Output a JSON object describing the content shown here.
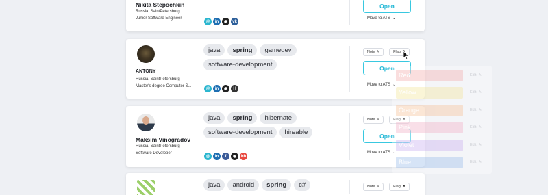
{
  "colors": {
    "open_accent": "#22b8d6",
    "tag_bg": "#e7e9ed"
  },
  "candidates": [
    {
      "name": "Nikita Stepochkin",
      "location": "Russia, SaintPetersburg",
      "title": "Junior Software Engineer",
      "tags": [],
      "socials": [
        "email-icon",
        "linkedin-icon",
        "github-icon",
        "vk-icon"
      ],
      "note_label": "",
      "flag_label": "",
      "open_label": "Open",
      "ats_label": "Move to ATS"
    },
    {
      "name": "ANTONY",
      "location": "Russia, SaintPetersburg",
      "title": "Master's degree Computer S...",
      "tags": [
        "java",
        "spring",
        "gamedev",
        "software-development"
      ],
      "socials": [
        "email-icon",
        "linkedin-icon",
        "github-icon",
        "habr-icon"
      ],
      "note_label": "Note",
      "flag_label": "Flag",
      "open_label": "Open",
      "ats_label": "Move to ATS"
    },
    {
      "name": "Maksim Vinogradov",
      "location": "Russia, SaintPetersburg",
      "title": "Software Developer",
      "tags": [
        "java",
        "spring",
        "hibernate",
        "software-development",
        "hireable"
      ],
      "socials": [
        "email-icon",
        "linkedin-icon",
        "facebook-icon",
        "github-icon",
        "hh-icon"
      ],
      "note_label": "Note",
      "flag_label": "Flag",
      "open_label": "Open",
      "ats_label": "Move to ATS"
    },
    {
      "name": "",
      "location": "",
      "title": "",
      "tags": [
        "java",
        "android",
        "spring",
        "c#"
      ],
      "socials": [],
      "note_label": "Note",
      "flag_label": "Flag",
      "open_label": "",
      "ats_label": ""
    }
  ],
  "flag_menu": {
    "items": [
      {
        "label": "Red",
        "color": "#f2a3a3",
        "edit": "Edit"
      },
      {
        "label": "Yellow",
        "color": "#f2e38f",
        "edit": "Edit"
      },
      {
        "label": "Orange",
        "color": "#f5b98a",
        "edit": "Edit"
      },
      {
        "label": "Pink",
        "color": "#f0a6bf",
        "edit": "Edit"
      },
      {
        "label": "Violet",
        "color": "#c3a6ee",
        "edit": "Edit"
      },
      {
        "label": "Blue",
        "color": "#8db4e8",
        "edit": "Edit"
      }
    ]
  }
}
